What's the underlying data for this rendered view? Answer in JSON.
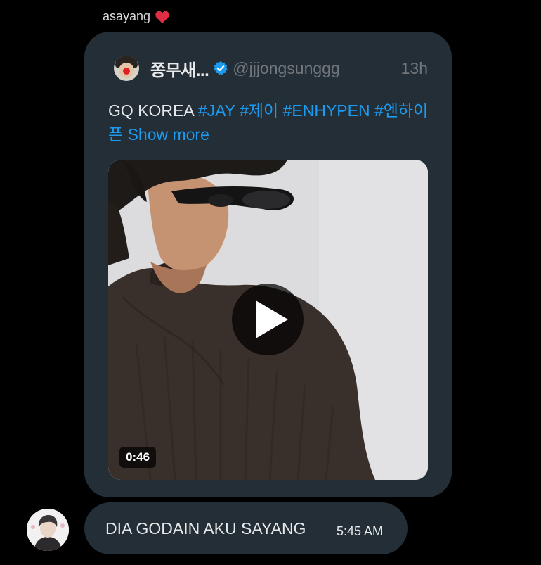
{
  "sender": {
    "name": "asayang",
    "heart_icon": "red-heart-icon"
  },
  "quoted_post": {
    "display_name": "쫑무새...",
    "verified_icon": "verified-badge-icon",
    "handle": "@jjjongsunggg",
    "time": "13h",
    "text_plain": "GQ KOREA ",
    "hashtags": [
      "#JAY",
      "#제이",
      "#ENHYPEN",
      "#엔하이픈"
    ],
    "show_more": "Show more",
    "video": {
      "duration": "0:46",
      "play_icon": "play-icon"
    }
  },
  "message": {
    "text": "DIA GODAIN AKU SAYANG",
    "time": "5:45 AM"
  },
  "colors": {
    "background": "#000000",
    "bubble": "#232e36",
    "link": "#1d9bf0",
    "muted": "#71767b",
    "heart": "#dd2e44",
    "verified": "#1d9bf0"
  }
}
